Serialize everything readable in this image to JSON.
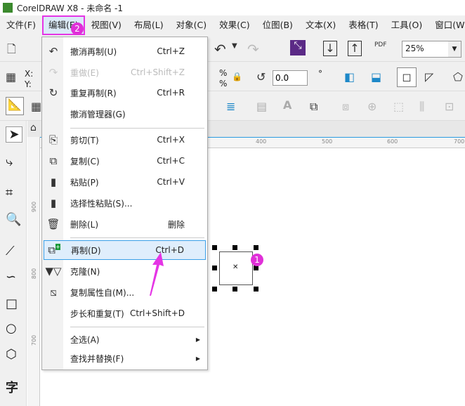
{
  "title": "CorelDRAW X8 - 未命名 -1",
  "menubar": [
    "文件(F)",
    "编辑(E)",
    "视图(V)",
    "布局(L)",
    "对象(C)",
    "效果(C)",
    "位图(B)",
    "文本(X)",
    "表格(T)",
    "工具(O)",
    "窗口(W)"
  ],
  "toolbar": {
    "zoom": "25%",
    "rotation": "0.0",
    "x_label": "X:",
    "y_label": "Y:",
    "pct": "%",
    "deg": "°",
    "pdf": "PDF"
  },
  "ruler": {
    "h": [
      "400",
      "500",
      "600",
      "700"
    ],
    "v": [
      "900",
      "800",
      "700"
    ]
  },
  "edit_menu": {
    "items": [
      {
        "label": "撤消再制(U)",
        "shortcut": "Ctrl+Z"
      },
      {
        "label": "重做(E)",
        "shortcut": "Ctrl+Shift+Z"
      },
      {
        "label": "重复再制(R)",
        "shortcut": "Ctrl+R"
      },
      {
        "label": "撤消管理器(G)",
        "shortcut": ""
      },
      {
        "label": "剪切(T)",
        "shortcut": "Ctrl+X"
      },
      {
        "label": "复制(C)",
        "shortcut": "Ctrl+C"
      },
      {
        "label": "粘贴(P)",
        "shortcut": "Ctrl+V"
      },
      {
        "label": "选择性粘贴(S)...",
        "shortcut": ""
      },
      {
        "label": "删除(L)",
        "shortcut": "删除"
      },
      {
        "label": "再制(D)",
        "shortcut": "Ctrl+D"
      },
      {
        "label": "克隆(N)",
        "shortcut": ""
      },
      {
        "label": "复制属性自(M)...",
        "shortcut": ""
      },
      {
        "label": "步长和重复(T)",
        "shortcut": "Ctrl+Shift+D"
      },
      {
        "label": "全选(A)",
        "shortcut": ""
      },
      {
        "label": "查找并替换(F)",
        "shortcut": ""
      }
    ]
  },
  "badges": {
    "one": "1",
    "two": "2"
  },
  "colors": {
    "highlight": "#dfeefc",
    "annotation": "#e030d8"
  }
}
